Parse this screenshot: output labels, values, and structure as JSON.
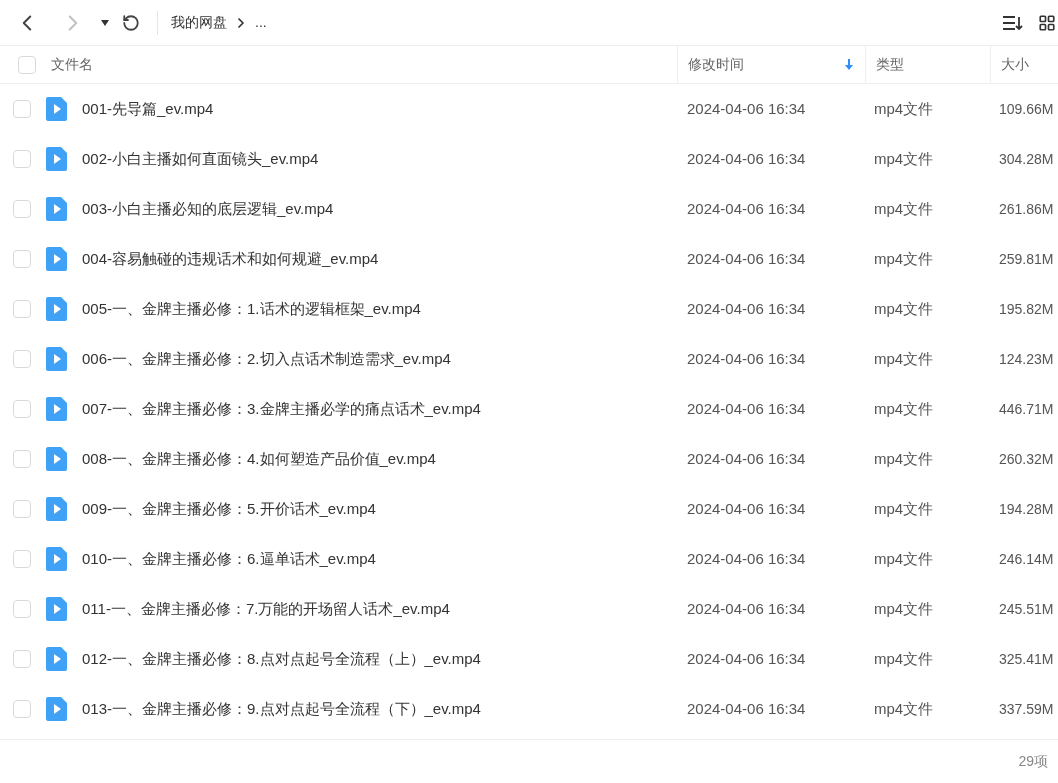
{
  "toolbar": {
    "back_disabled": false,
    "forward_disabled": true,
    "breadcrumb": [
      "我的网盘",
      "..."
    ]
  },
  "table": {
    "select_all_checked": false,
    "columns": [
      {
        "label": "文件名",
        "sorted": false
      },
      {
        "label": "修改时间",
        "sorted": true
      },
      {
        "label": "类型",
        "sorted": false
      },
      {
        "label": "大小",
        "sorted": false
      }
    ],
    "rows": [
      {
        "name": "001-先导篇_ev.mp4",
        "modified": "2024-04-06 16:34",
        "type": "mp4文件",
        "size": "109.66M",
        "checked": false
      },
      {
        "name": "002-小白主播如何直面镜头_ev.mp4",
        "modified": "2024-04-06 16:34",
        "type": "mp4文件",
        "size": "304.28M",
        "checked": false
      },
      {
        "name": "003-小白主播必知的底层逻辑_ev.mp4",
        "modified": "2024-04-06 16:34",
        "type": "mp4文件",
        "size": "261.86M",
        "checked": false
      },
      {
        "name": "004-容易触碰的违规话术和如何规避_ev.mp4",
        "modified": "2024-04-06 16:34",
        "type": "mp4文件",
        "size": "259.81M",
        "checked": false
      },
      {
        "name": "005-一、金牌主播必修：1.话术的逻辑框架_ev.mp4",
        "modified": "2024-04-06 16:34",
        "type": "mp4文件",
        "size": "195.82M",
        "checked": false
      },
      {
        "name": "006-一、金牌主播必修：2.切入点话术制造需求_ev.mp4",
        "modified": "2024-04-06 16:34",
        "type": "mp4文件",
        "size": "124.23M",
        "checked": false
      },
      {
        "name": "007-一、金牌主播必修：3.金牌主播必学的痛点话术_ev.mp4",
        "modified": "2024-04-06 16:34",
        "type": "mp4文件",
        "size": "446.71M",
        "checked": false
      },
      {
        "name": "008-一、金牌主播必修：4.如何塑造产品价值_ev.mp4",
        "modified": "2024-04-06 16:34",
        "type": "mp4文件",
        "size": "260.32M",
        "checked": false
      },
      {
        "name": "009-一、金牌主播必修：5.开价话术_ev.mp4",
        "modified": "2024-04-06 16:34",
        "type": "mp4文件",
        "size": "194.28M",
        "checked": false
      },
      {
        "name": "010-一、金牌主播必修：6.逼单话术_ev.mp4",
        "modified": "2024-04-06 16:34",
        "type": "mp4文件",
        "size": "246.14M",
        "checked": false
      },
      {
        "name": "011-一、金牌主播必修：7.万能的开场留人话术_ev.mp4",
        "modified": "2024-04-06 16:34",
        "type": "mp4文件",
        "size": "245.51M",
        "checked": false
      },
      {
        "name": "012-一、金牌主播必修：8.点对点起号全流程（上）_ev.mp4",
        "modified": "2024-04-06 16:34",
        "type": "mp4文件",
        "size": "325.41M",
        "checked": false
      },
      {
        "name": "013-一、金牌主播必修：9.点对点起号全流程（下）_ev.mp4",
        "modified": "2024-04-06 16:34",
        "type": "mp4文件",
        "size": "337.59M",
        "checked": false
      }
    ]
  },
  "status_bar": {
    "count": "29项"
  }
}
